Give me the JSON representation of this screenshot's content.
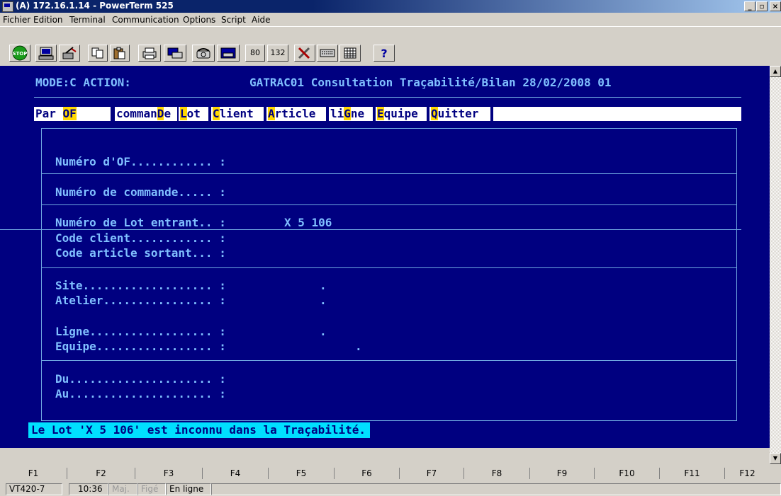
{
  "window": {
    "title": "(A) 172.16.1.14 - PowerTerm 525",
    "minimize": "_",
    "maximize": "▫",
    "close": "×"
  },
  "menubar": [
    "Fichier",
    "Edition",
    "Terminal",
    "Communication",
    "Options",
    "Script",
    "Aide"
  ],
  "toolbar": {
    "col80": "80",
    "col132": "132",
    "icons": [
      "stop-icon",
      "computer-icon",
      "connect-icon",
      "copy-icon",
      "paste-icon",
      "print-icon",
      "print-screen-icon",
      "phone-icon",
      "modem-icon",
      "col80",
      "col132",
      "tools-icon",
      "keyboard-icon",
      "grid-icon",
      "help-icon"
    ]
  },
  "terminal": {
    "mode": "MODE:C ACTION:",
    "header": "GATRAC01 Consultation Traçabilité/Bilan 28/02/2008 01",
    "menu": [
      {
        "pre": "Par ",
        "hk": "OF",
        "post": ""
      },
      {
        "pre": "comman",
        "hk": "D",
        "post": "e"
      },
      {
        "pre": "",
        "hk": "L",
        "post": "ot"
      },
      {
        "pre": "",
        "hk": "C",
        "post": "lient"
      },
      {
        "pre": "",
        "hk": "A",
        "post": "rticle"
      },
      {
        "pre": "li",
        "hk": "G",
        "post": "ne"
      },
      {
        "pre": "",
        "hk": "E",
        "post": "quipe"
      },
      {
        "pre": "",
        "hk": "Q",
        "post": "uitter"
      }
    ],
    "fields": {
      "num_of": "Numéro d'OF............ :",
      "num_commande": "Numéro de commande..... :",
      "num_lot_label": "Numéro de Lot entrant.. :",
      "num_lot_value": "X 5 106",
      "code_client": "Code client............ :",
      "code_article": "Code article sortant... :",
      "site": "Site................... :",
      "atelier": "Atelier................ :",
      "ligne": "Ligne.................. :",
      "equipe": "Equipe................. :",
      "du": "Du..................... :",
      "au": "Au..................... :",
      "dot": "."
    },
    "message": "Le Lot 'X 5 106' est inconnu dans la Traçabilité."
  },
  "function_keys": [
    "F1",
    "F2",
    "F3",
    "F4",
    "F5",
    "F6",
    "F7",
    "F8",
    "F9",
    "F10",
    "F11",
    "F12"
  ],
  "status": {
    "emulation": "VT420-7",
    "time": "10:36",
    "maj": "Maj.",
    "fige": "Figé",
    "online": "En ligne"
  },
  "colors": {
    "terminal_bg": "#000080",
    "terminal_text": "#80c0ff",
    "hotkey": "#ffd800",
    "message_bg": "#00e0ff"
  }
}
